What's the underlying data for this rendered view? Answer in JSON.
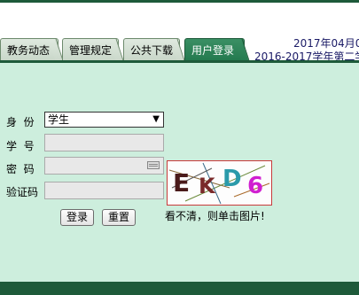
{
  "tabs": [
    {
      "label": "教务动态",
      "active": false
    },
    {
      "label": "管理规定",
      "active": false
    },
    {
      "label": "公共下载",
      "active": false
    },
    {
      "label": "用户登录",
      "active": true
    }
  ],
  "header": {
    "date_text": "2017年04月0",
    "term_text": "2016-2017学年第二学"
  },
  "form": {
    "identity_label": "身  份",
    "identity_value": "学生",
    "student_id_label": "学  号",
    "password_label": "密  码",
    "captcha_label": "验证码",
    "captcha_chars": [
      "E",
      "K",
      "D",
      "6"
    ],
    "captcha_hint": "看不清，则单击图片!",
    "login_button": "登录",
    "reset_button": "重置"
  },
  "colors": {
    "accent": "#1e5a3a",
    "background": "#cdeedd"
  }
}
